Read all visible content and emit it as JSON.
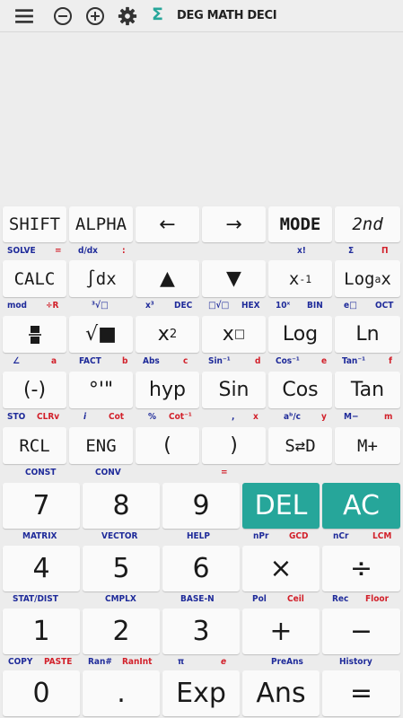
{
  "toolbar": {
    "mode_text": "DEG MATH DECI",
    "sigma_label": "Σ",
    "icons": [
      "menu-icon",
      "zoom-out-icon",
      "zoom-in-icon",
      "gear-icon",
      "sigma-icon"
    ],
    "accent": "#26a69a"
  },
  "display": {
    "expression": "",
    "result": ""
  },
  "row1": {
    "keys": [
      "SHIFT",
      "ALPHA",
      "←",
      "→",
      "MODE",
      "2nd"
    ],
    "labels": [
      {
        "text": "SOLVE",
        "color": "blue"
      },
      {
        "text": "=",
        "color": "red"
      },
      {
        "text": "d/dx",
        "color": "blue"
      },
      {
        "text": ":",
        "color": "red"
      },
      {
        "text": "x!",
        "color": "blue"
      },
      {
        "text": "Σ",
        "color": "blue"
      },
      {
        "text": "Π",
        "color": "red"
      }
    ]
  },
  "row2": {
    "keys": [
      "CALC",
      "∫dx",
      "▲",
      "▼",
      "x-1",
      "LogaX"
    ],
    "key_parts": {
      "x_inv_base": "x",
      "x_inv_exp": "-1",
      "log_base": "Log",
      "log_sub": "a",
      "log_x": "x"
    },
    "labels": [
      {
        "text": "mod",
        "color": "blue"
      },
      {
        "text": "÷R",
        "color": "red"
      },
      {
        "text": "³√□",
        "color": "blue"
      },
      {
        "text": "x³",
        "color": "blue"
      },
      {
        "text": "DEC",
        "color": "blue"
      },
      {
        "text": "□√□",
        "color": "blue"
      },
      {
        "text": "HEX",
        "color": "blue"
      },
      {
        "text": "10ˣ",
        "color": "blue"
      },
      {
        "text": "BIN",
        "color": "blue"
      },
      {
        "text": "e□",
        "color": "blue"
      },
      {
        "text": "OCT",
        "color": "blue"
      }
    ]
  },
  "row3": {
    "keys": [
      "fraction",
      "√■",
      "x2",
      "x□",
      "Log",
      "Ln"
    ],
    "key_parts": {
      "sq_base": "x",
      "sq_exp": "2",
      "pow_base": "x",
      "pow_exp": "□"
    },
    "labels": [
      {
        "text": "∠",
        "color": "blue"
      },
      {
        "text": "a",
        "color": "red"
      },
      {
        "text": "FACT",
        "color": "blue"
      },
      {
        "text": "b",
        "color": "red"
      },
      {
        "text": "Abs",
        "color": "blue"
      },
      {
        "text": "c",
        "color": "red"
      },
      {
        "text": "Sin⁻¹",
        "color": "blue"
      },
      {
        "text": "d",
        "color": "red"
      },
      {
        "text": "Cos⁻¹",
        "color": "blue"
      },
      {
        "text": "e",
        "color": "red"
      },
      {
        "text": "Tan⁻¹",
        "color": "blue"
      },
      {
        "text": "f",
        "color": "red"
      }
    ]
  },
  "row4": {
    "keys": [
      "(-)",
      "°'\"",
      "hyp",
      "Sin",
      "Cos",
      "Tan"
    ],
    "labels": [
      {
        "text": "STO",
        "color": "blue"
      },
      {
        "text": "CLRv",
        "color": "red"
      },
      {
        "text": "i",
        "color": "blue"
      },
      {
        "text": "Cot",
        "color": "red"
      },
      {
        "text": "%",
        "color": "blue"
      },
      {
        "text": "Cot⁻¹",
        "color": "red"
      },
      {
        "text": ",",
        "color": "blue"
      },
      {
        "text": "x",
        "color": "red"
      },
      {
        "text": "aᵇ/c",
        "color": "blue"
      },
      {
        "text": "y",
        "color": "red"
      },
      {
        "text": "M−",
        "color": "blue"
      },
      {
        "text": "m",
        "color": "red"
      }
    ]
  },
  "row5": {
    "keys": [
      "RCL",
      "ENG",
      "(",
      ")",
      "S⇄D",
      "M+"
    ],
    "labels": [
      {
        "text": "CONST",
        "color": "blue"
      },
      {
        "text": "CONV",
        "color": "blue"
      },
      {
        "text": "=",
        "color": "red"
      }
    ]
  },
  "row6": {
    "keys": [
      "7",
      "8",
      "9",
      "DEL",
      "AC"
    ],
    "labels": [
      {
        "text": "MATRIX",
        "color": "blue"
      },
      {
        "text": "VECTOR",
        "color": "blue"
      },
      {
        "text": "HELP",
        "color": "blue"
      },
      {
        "text": "nPr",
        "color": "blue"
      },
      {
        "text": "GCD",
        "color": "red"
      },
      {
        "text": "nCr",
        "color": "blue"
      },
      {
        "text": "LCM",
        "color": "red"
      }
    ]
  },
  "row7": {
    "keys": [
      "4",
      "5",
      "6",
      "×",
      "÷"
    ],
    "labels": [
      {
        "text": "STAT/DIST",
        "color": "blue"
      },
      {
        "text": "CMPLX",
        "color": "blue"
      },
      {
        "text": "BASE-N",
        "color": "blue"
      },
      {
        "text": "Pol",
        "color": "blue"
      },
      {
        "text": "Ceil",
        "color": "red"
      },
      {
        "text": "Rec",
        "color": "blue"
      },
      {
        "text": "Floor",
        "color": "red"
      }
    ]
  },
  "row8": {
    "keys": [
      "1",
      "2",
      "3",
      "+",
      "−"
    ],
    "labels": [
      {
        "text": "COPY",
        "color": "blue"
      },
      {
        "text": "PASTE",
        "color": "red"
      },
      {
        "text": "Ran#",
        "color": "blue"
      },
      {
        "text": "RanInt",
        "color": "red"
      },
      {
        "text": "π",
        "color": "blue"
      },
      {
        "text": "e",
        "color": "red"
      },
      {
        "text": "PreAns",
        "color": "blue"
      },
      {
        "text": "History",
        "color": "blue"
      }
    ]
  },
  "row9": {
    "keys": [
      "0",
      ".",
      "Exp",
      "Ans",
      "="
    ]
  }
}
